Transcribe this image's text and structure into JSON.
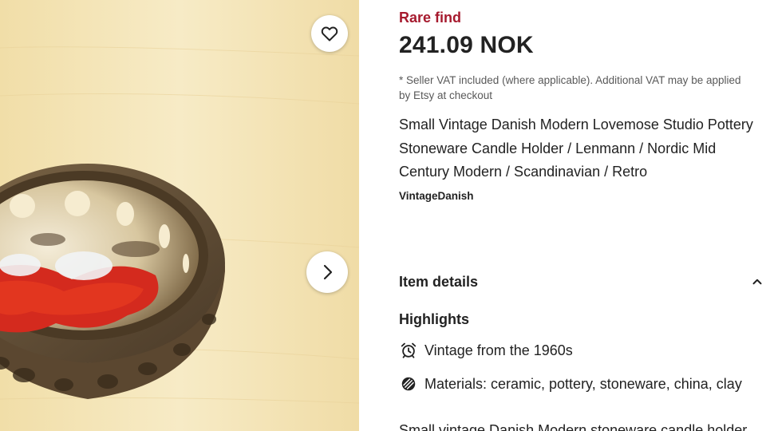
{
  "listing": {
    "badge": "Rare find",
    "price": "241.09 NOK",
    "vat_note": "* Seller VAT included (where applicable). Additional VAT may be applied by Etsy at checkout",
    "title": "Small Vintage Danish Modern Lovemose Studio Pottery Stoneware Candle Holder / Lenmann / Nordic Mid Century Modern / Scandinavian / Retro",
    "shop_name": "VintageDanish"
  },
  "gallery": {
    "favorite_icon": "heart-icon",
    "next_icon": "chevron-right-icon"
  },
  "item_details": {
    "heading": "Item details",
    "toggle_icon": "chevron-up-icon",
    "highlights_heading": "Highlights",
    "highlights": [
      {
        "icon": "alarm-clock-icon",
        "text": "Vintage from the 1960s"
      },
      {
        "icon": "materials-icon",
        "text": "Materials: ceramic, pottery, stoneware, china, clay"
      }
    ],
    "description_start": "Small vintage Danish Modern stoneware candle holder"
  },
  "colors": {
    "badge": "#a61a2e",
    "text": "#222222",
    "muted": "#595959"
  }
}
